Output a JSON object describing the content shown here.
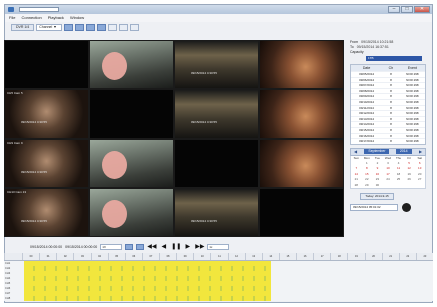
{
  "window": {
    "title": "",
    "icon": "app-icon",
    "buttons": [
      "minimize",
      "maximize",
      "close"
    ],
    "close_glyph": "✕",
    "min_glyph": "–",
    "max_glyph": "□"
  },
  "menu": [
    "File",
    "Connection",
    "Playback",
    "Window"
  ],
  "toolbar": {
    "tab_label": "DVR 1/4",
    "channel_select": "Channel ▼",
    "accent": "#8aa9d8"
  },
  "cameras": [
    {
      "label": "",
      "scene": "black",
      "blurred": false,
      "timestamp": ""
    },
    {
      "label": "",
      "scene": "office",
      "blurred": true,
      "timestamp": ""
    },
    {
      "label": "",
      "scene": "lamp",
      "blurred": false,
      "timestamp": "09/15/2014 4:30:55"
    },
    {
      "label": "",
      "scene": "warm",
      "blurred": false,
      "timestamp": ""
    },
    {
      "label": "CH5 Cam 5",
      "scene": "face",
      "blurred": false,
      "timestamp": "09/15/2014 4:30:55"
    },
    {
      "label": "",
      "scene": "black",
      "blurred": false,
      "timestamp": ""
    },
    {
      "label": "",
      "scene": "lamp",
      "blurred": false,
      "timestamp": "09/15/2014 4:30:55"
    },
    {
      "label": "",
      "scene": "warm",
      "blurred": false,
      "timestamp": ""
    },
    {
      "label": "CH9 Cam 9",
      "scene": "face",
      "blurred": false,
      "timestamp": "09/15/2014 4:30:55"
    },
    {
      "label": "",
      "scene": "office",
      "blurred": true,
      "timestamp": ""
    },
    {
      "label": "",
      "scene": "black",
      "blurred": false,
      "timestamp": ""
    },
    {
      "label": "",
      "scene": "warm",
      "blurred": false,
      "timestamp": ""
    },
    {
      "label": "CH13 Cam 13",
      "scene": "face",
      "blurred": false,
      "timestamp": "09/15/2014 4:30:55"
    },
    {
      "label": "",
      "scene": "office",
      "blurred": true,
      "timestamp": ""
    },
    {
      "label": "",
      "scene": "lamp",
      "blurred": false,
      "timestamp": "09/15/2014 4:30:55"
    },
    {
      "label": "",
      "scene": "black",
      "blurred": false,
      "timestamp": ""
    }
  ],
  "info": {
    "from_label": "From",
    "from_value": "09/15/2014 10:21:58",
    "to_label": "To",
    "to_value": "09/15/2014 16:37:51",
    "capacity_label": "Capacity",
    "capacity_value": "1TB"
  },
  "records": {
    "headers": [
      "Date",
      "Ch",
      "Event"
    ],
    "rows": [
      [
        "09/05/2014",
        "8",
        "NOR 298"
      ],
      [
        "09/06/2014",
        "8",
        "NOR 298"
      ],
      [
        "09/07/2014",
        "8",
        "NOR 298"
      ],
      [
        "09/08/2014",
        "8",
        "NOR 298"
      ],
      [
        "09/09/2014",
        "8",
        "NOR 298"
      ],
      [
        "09/10/2014",
        "8",
        "NOR 298"
      ],
      [
        "09/11/2014",
        "8",
        "NOR 298"
      ],
      [
        "09/12/2014",
        "8",
        "NOR 298"
      ],
      [
        "09/13/2014",
        "8",
        "NOR 298"
      ],
      [
        "09/14/2014",
        "8",
        "NOR 298"
      ],
      [
        "09/15/2014",
        "8",
        "NOR 298"
      ],
      [
        "09/16/2014",
        "8",
        "NOR 298"
      ],
      [
        "09/17/2014",
        "8",
        "NOR 298"
      ]
    ]
  },
  "calendar": {
    "month_label": "September",
    "year": "2014",
    "prev_glyph": "◀",
    "next_glyph": "▶",
    "dow": [
      "Sun",
      "Mon",
      "Tue",
      "Wed",
      "Thu",
      "Fri",
      "Sat"
    ],
    "days": [
      "",
      "1",
      "2",
      "3",
      "4",
      "5",
      "6",
      "7",
      "8",
      "9",
      "10",
      "11",
      "12",
      "13",
      "14",
      "15",
      "16",
      "17",
      "18",
      "19",
      "20",
      "21",
      "22",
      "23",
      "24",
      "25",
      "26",
      "27",
      "28",
      "29",
      "30",
      "",
      "",
      ""
    ],
    "marked_days": [
      "5",
      "6",
      "7",
      "8",
      "9",
      "10",
      "11",
      "12",
      "13",
      "14",
      "15",
      "16",
      "17"
    ]
  },
  "today_button": "Today: 2014-9-15",
  "date_input": "09/15/2014 05:01:02",
  "playback": {
    "start": "09/15/2014 00:00:00",
    "end": "09/15/2014 00:00:00",
    "speed_select": "1X",
    "jog_select": "1x",
    "buttons": [
      "◀◀",
      "◀",
      "❚❚",
      "▶",
      "▶▶"
    ]
  },
  "timeline": {
    "hours": [
      "00",
      "01",
      "02",
      "03",
      "04",
      "05",
      "06",
      "07",
      "08",
      "09",
      "10",
      "11",
      "12",
      "13",
      "14",
      "15",
      "16",
      "17",
      "18",
      "19",
      "20",
      "21",
      "22",
      "23"
    ],
    "channels": [
      "CH1",
      "CH2",
      "CH3",
      "CH4",
      "CH5",
      "CH6",
      "CH7",
      "CH8"
    ],
    "bar_color": "#f2e63d"
  }
}
